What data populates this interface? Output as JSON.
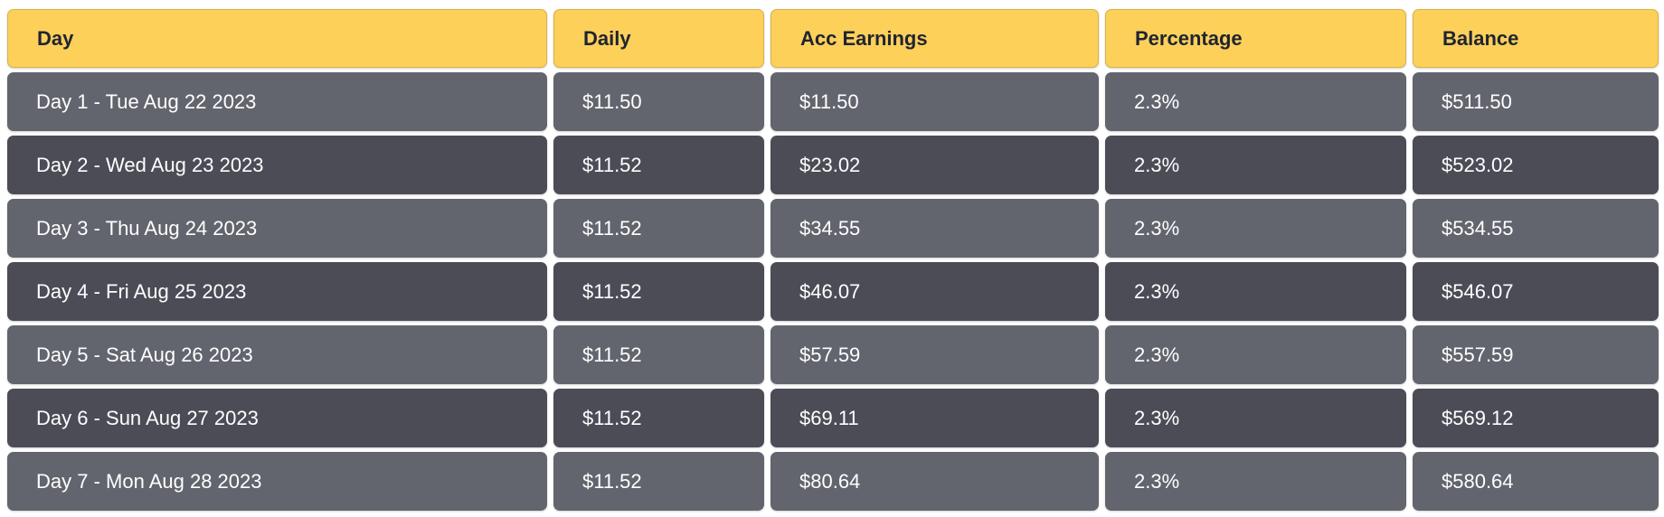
{
  "table": {
    "headers": [
      "Day",
      "Daily",
      "Acc Earnings",
      "Percentage",
      "Balance"
    ],
    "rows": [
      [
        "Day 1 - Tue Aug 22 2023",
        "$11.50",
        "$11.50",
        "2.3%",
        "$511.50"
      ],
      [
        "Day 2 - Wed Aug 23 2023",
        "$11.52",
        "$23.02",
        "2.3%",
        "$523.02"
      ],
      [
        "Day 3 - Thu Aug 24 2023",
        "$11.52",
        "$34.55",
        "2.3%",
        "$534.55"
      ],
      [
        "Day 4 - Fri Aug 25 2023",
        "$11.52",
        "$46.07",
        "2.3%",
        "$546.07"
      ],
      [
        "Day 5 - Sat Aug 26 2023",
        "$11.52",
        "$57.59",
        "2.3%",
        "$557.59"
      ],
      [
        "Day 6 - Sun Aug 27 2023",
        "$11.52",
        "$69.11",
        "2.3%",
        "$569.12"
      ],
      [
        "Day 7 - Mon Aug 28 2023",
        "$11.52",
        "$80.64",
        "2.3%",
        "$580.64"
      ]
    ]
  },
  "colors": {
    "header_bg": "#fdd05a",
    "header_text": "#1f2430",
    "row_light": "#62656d",
    "row_dark": "#4c4c57",
    "cell_text": "#ffffff"
  }
}
